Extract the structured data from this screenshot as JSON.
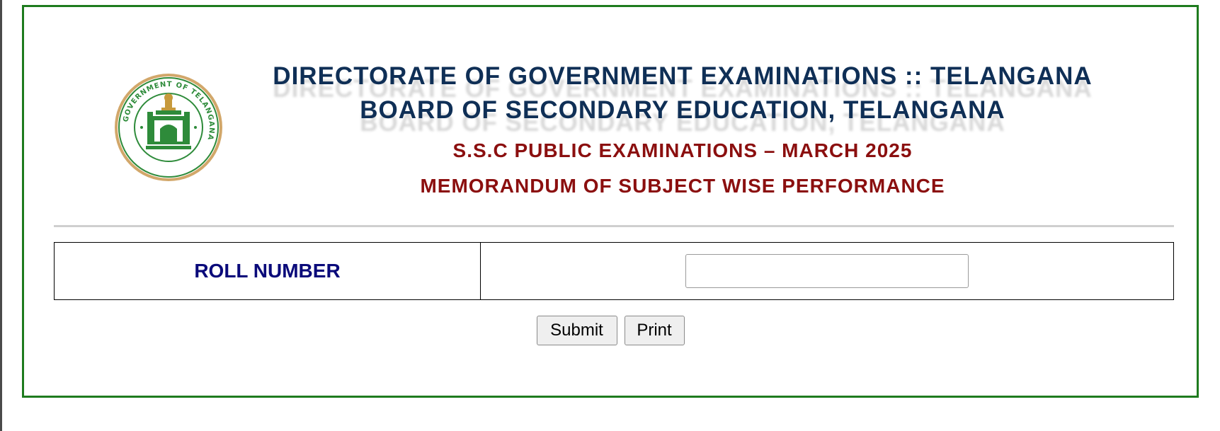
{
  "header": {
    "line1": "DIRECTORATE OF GOVERNMENT EXAMINATIONS :: TELANGANA",
    "line2": "BOARD OF SECONDARY EDUCATION, TELANGANA",
    "line3": "S.S.C PUBLIC EXAMINATIONS – MARCH 2025",
    "line4": "MEMORANDUM OF SUBJECT WISE PERFORMANCE"
  },
  "emblem": {
    "ring_text": "GOVERNMENT OF TELANGANA",
    "icon": "government-of-telangana-emblem"
  },
  "form": {
    "roll_label": "ROLL NUMBER",
    "roll_value": "",
    "roll_placeholder": ""
  },
  "buttons": {
    "submit_label": "Submit",
    "print_label": "Print"
  },
  "colors": {
    "frame_border": "#1e7b1e",
    "heading_blue": "#0f2f56",
    "heading_red": "#8b0f0f",
    "label_blue": "#0a0a7a",
    "emblem_green": "#2e8b3a",
    "emblem_gold": "#d2a76a"
  }
}
